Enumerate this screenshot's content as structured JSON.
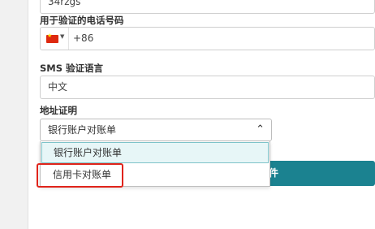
{
  "form": {
    "top_field_value": "34rzgs",
    "phone_label": "用于验证的电话号码",
    "phone_dial_code": "+86",
    "sms_lang_label": "SMS 验证语言",
    "sms_lang_value": "中文",
    "address_proof_label": "地址证明",
    "address_proof_selected": "银行账户对账单",
    "address_proof_options": [
      "银行账户对账单",
      "信用卡对账单"
    ],
    "submit_partial_label": "件"
  },
  "colors": {
    "accent": "#1b8290",
    "highlight_bg": "#e7f6f7",
    "annotation_red": "#e0241b"
  },
  "icons": {
    "flag": "china-flag-icon",
    "dropdown": "chevron-up-icon"
  }
}
